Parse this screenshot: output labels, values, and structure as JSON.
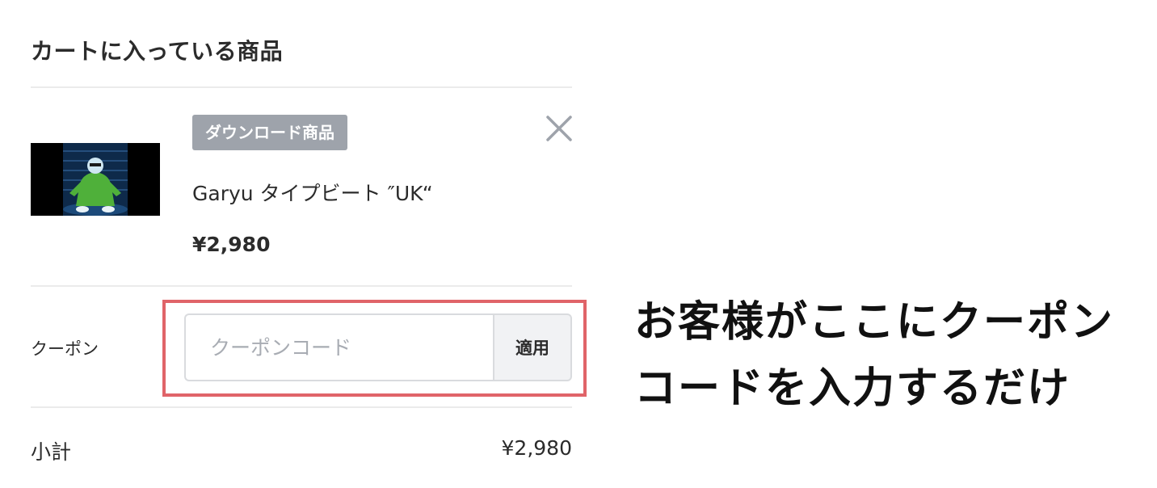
{
  "cart": {
    "title": "カートに入っている商品",
    "item": {
      "badge": "ダウンロード商品",
      "name": "Garyu タイプビート ″UK“",
      "price": "¥2,980"
    }
  },
  "coupon": {
    "label": "クーポン",
    "placeholder": "クーポンコード",
    "value": "",
    "apply_label": "適用"
  },
  "annotation": {
    "line1": "お客様がここにクーポン",
    "line2": "コードを入力するだけ"
  },
  "summary": {
    "subtotal_label": "小計",
    "subtotal_value": "¥2,980"
  },
  "icons": {
    "remove": "close-icon"
  },
  "colors": {
    "badge_bg": "#9ea3ab",
    "highlight_border": "#e06469",
    "apply_bg": "#f1f2f4"
  }
}
